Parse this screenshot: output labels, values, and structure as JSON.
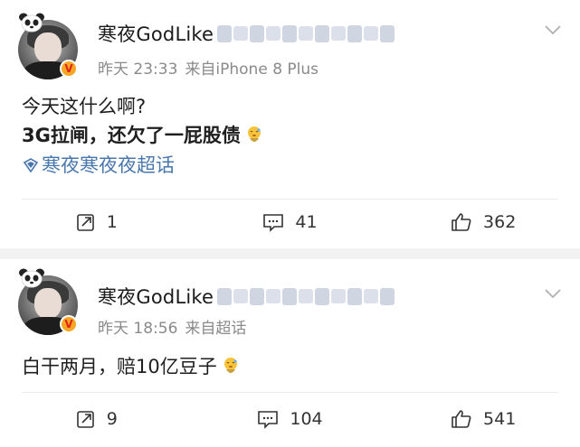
{
  "posts": [
    {
      "username": "寒夜GodLike",
      "time": "昨天 23:33",
      "source": "来自iPhone 8 Plus",
      "lines": [
        "今天这什么啊?",
        "3G拉闸，还欠了一屁股债"
      ],
      "topic": "寒夜寒夜夜超话",
      "repost_count": "1",
      "comment_count": "41",
      "like_count": "362"
    },
    {
      "username": "寒夜GodLike",
      "time": "昨天 18:56",
      "source": "来自超话",
      "lines": [
        "白干两月，赔10亿豆子"
      ],
      "repost_count": "9",
      "comment_count": "104",
      "like_count": "541"
    }
  ],
  "colors": {
    "topic": "#4a77ad",
    "meta": "#8a8a8a",
    "verify_badge": "#f5a623"
  },
  "icons": {
    "repost": "repost-icon",
    "comment": "comment-icon",
    "like": "thumbs-up-icon",
    "more": "chevron-down-icon",
    "topic": "super-topic-icon",
    "emoji": "embarrassed-emoji-icon"
  }
}
